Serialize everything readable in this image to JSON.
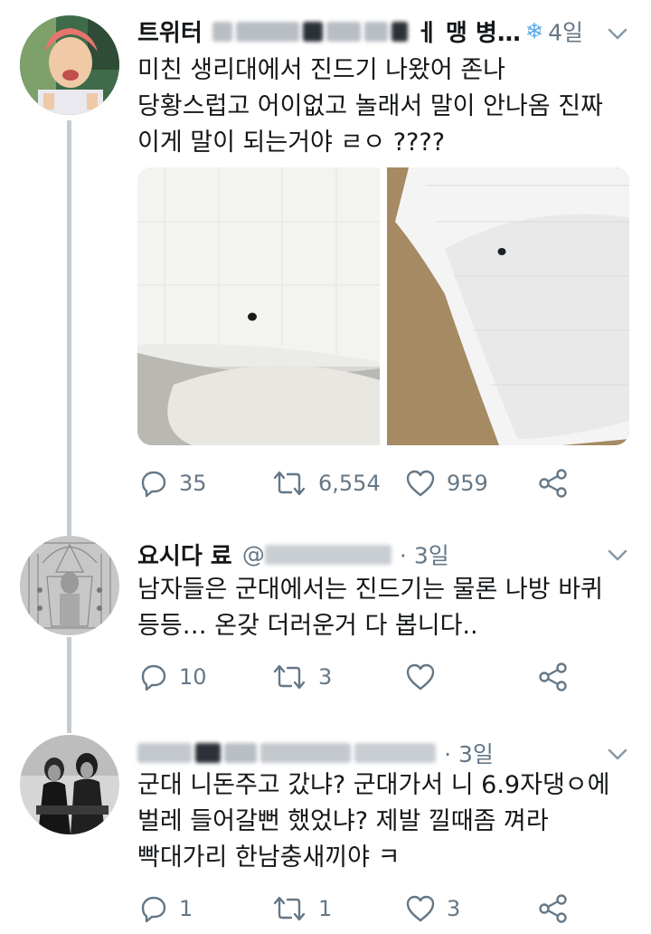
{
  "tweets": [
    {
      "name": "트위터",
      "name_tail": "ㅔ 맹 병…",
      "time": "4일",
      "lines": [
        "미친 생리대에서 진드기 나왔어 존나",
        "당황스럽고 어이없고 놀래서 말이 안나옴 진짜",
        "이게 말이 되는거야 ㄹㅇ ????"
      ],
      "replies": "35",
      "retweets": "6,554",
      "likes": "959"
    },
    {
      "name": "요시다 료",
      "handle": "@",
      "time": "· 3일",
      "lines": [
        "남자들은 군대에서는 진드기는 물론 나방 바퀴",
        "등등… 온갖 더러운거 다 봅니다.."
      ],
      "replies": "10",
      "retweets": "3",
      "likes": ""
    },
    {
      "time": "· 3일",
      "lines": [
        "군대 니돈주고 갔냐? 군대가서 니 6.9자댕ㅇ에",
        "벌레 들어갈뻔 했었냐? 제발 낄때좀 껴라",
        "빡대가리 한남충새끼야 ㅋ"
      ],
      "replies": "1",
      "retweets": "1",
      "likes": "3"
    }
  ],
  "colors": {
    "text": "#14171a",
    "secondary": "#657786",
    "thread_line": "#c4ccd3",
    "divider": "#e6ecf0"
  }
}
